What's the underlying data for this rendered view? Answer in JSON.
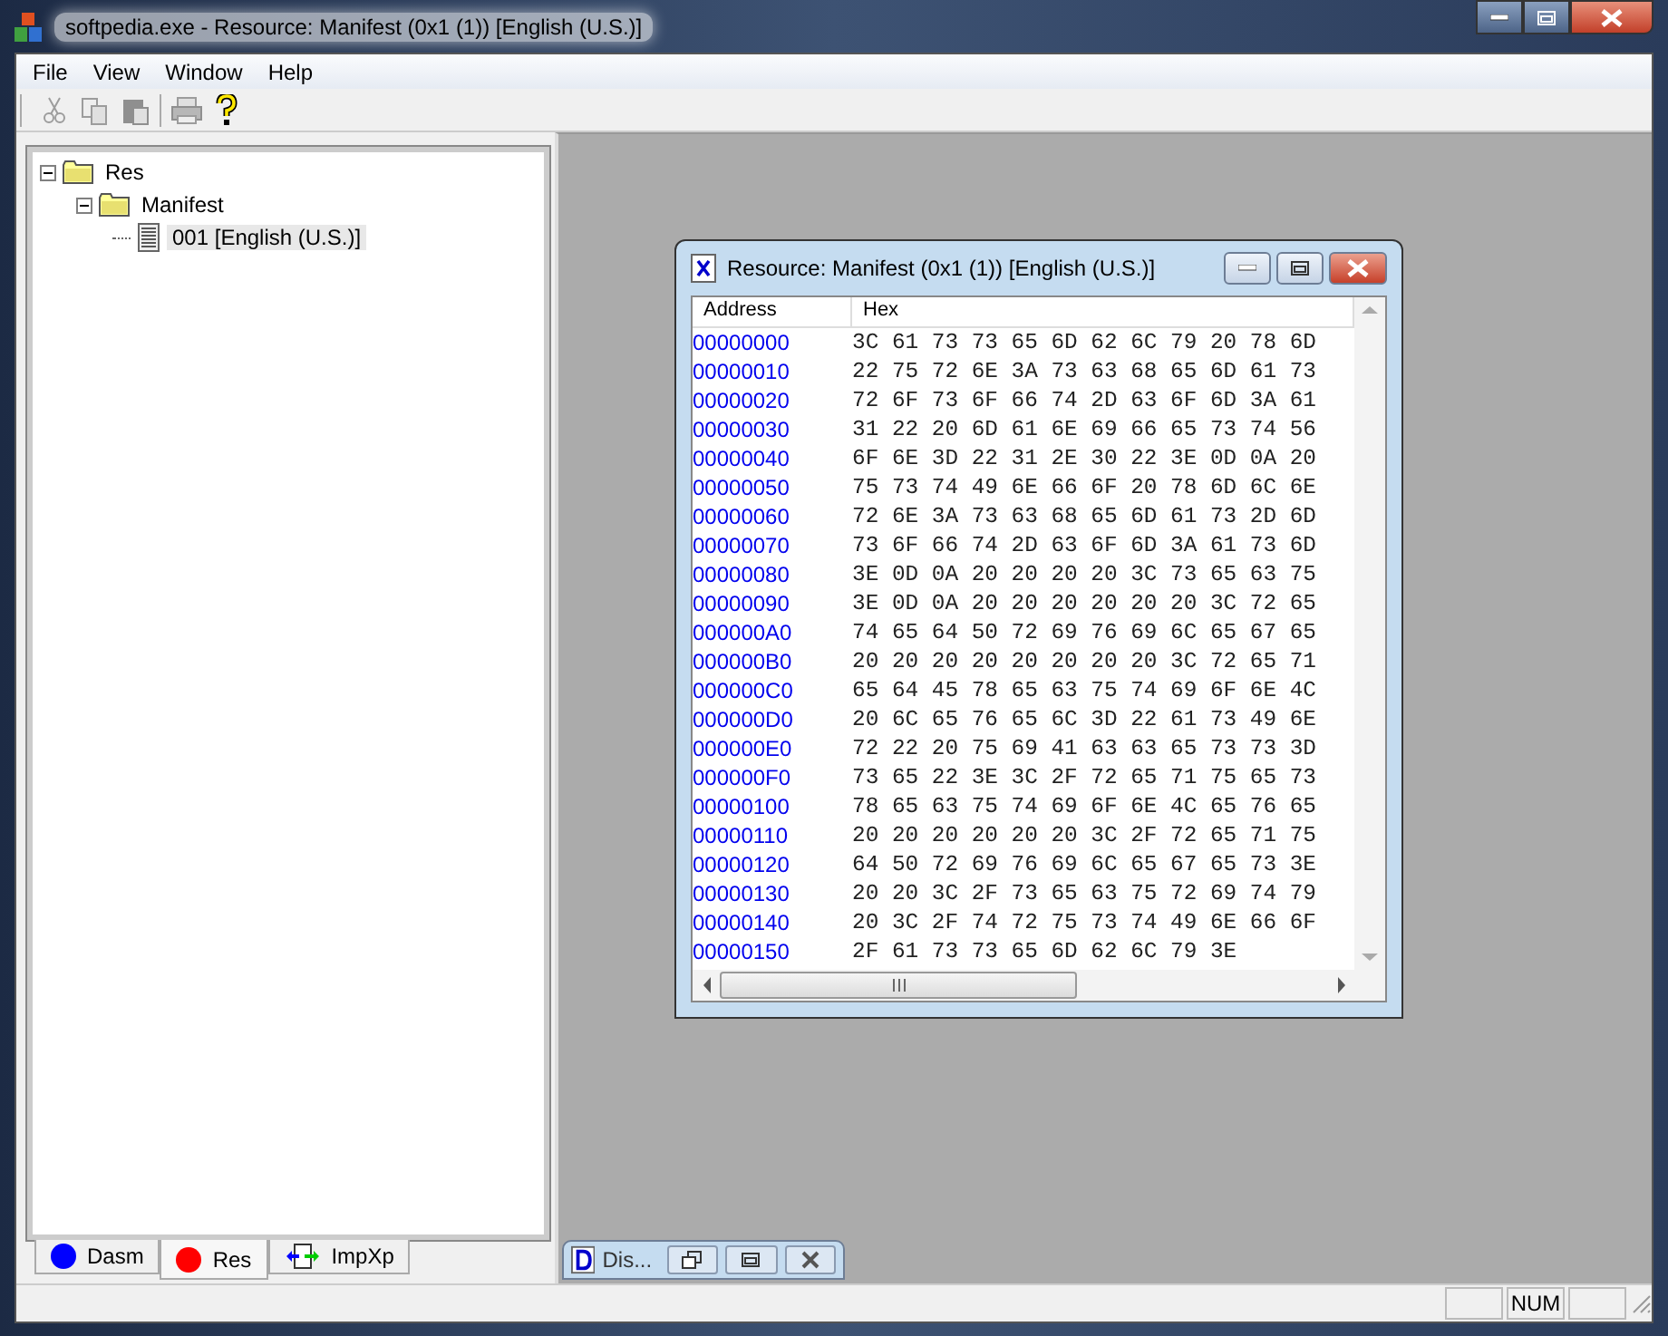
{
  "window": {
    "title": "softpedia.exe - Resource: Manifest (0x1 (1)) [English (U.S.)]"
  },
  "menu": [
    "File",
    "View",
    "Window",
    "Help"
  ],
  "toolbar": [
    {
      "kind": "cut",
      "disabled": true
    },
    {
      "kind": "copy",
      "disabled": true
    },
    {
      "kind": "paste",
      "disabled": true
    },
    {
      "kind": "print",
      "disabled": true
    },
    {
      "kind": "help",
      "disabled": false
    }
  ],
  "tree": [
    {
      "label": "Res",
      "kind": "folder",
      "expanded": true,
      "selected": false,
      "children": [
        {
          "label": "Manifest",
          "kind": "folder",
          "expanded": true,
          "selected": false,
          "children": [
            {
              "label": "001 [English (U.S.)]",
              "kind": "file",
              "selected": true
            }
          ]
        }
      ]
    }
  ],
  "panel_tabs": [
    {
      "label": "Dasm",
      "kind": "dot",
      "color": "#0000ff",
      "selected": false
    },
    {
      "label": "Res",
      "kind": "dot",
      "color": "#ff0000",
      "selected": true
    },
    {
      "label": "ImpXp",
      "kind": "arrows",
      "selected": false
    }
  ],
  "child_window": {
    "title": "Resource: Manifest (0x1 (1)) [English (U.S.)]",
    "columns": [
      "Address",
      "Hex"
    ],
    "rows": [
      {
        "address": "00000000",
        "hex": "3C 61 73 73 65 6D 62 6C 79 20 78 6D"
      },
      {
        "address": "00000010",
        "hex": "22 75 72 6E 3A 73 63 68 65 6D 61 73"
      },
      {
        "address": "00000020",
        "hex": "72 6F 73 6F 66 74 2D 63 6F 6D 3A 61"
      },
      {
        "address": "00000030",
        "hex": "31 22 20 6D 61 6E 69 66 65 73 74 56"
      },
      {
        "address": "00000040",
        "hex": "6F 6E 3D 22 31 2E 30 22 3E 0D 0A 20"
      },
      {
        "address": "00000050",
        "hex": "75 73 74 49 6E 66 6F 20 78 6D 6C 6E"
      },
      {
        "address": "00000060",
        "hex": "72 6E 3A 73 63 68 65 6D 61 73 2D 6D"
      },
      {
        "address": "00000070",
        "hex": "73 6F 66 74 2D 63 6F 6D 3A 61 73 6D"
      },
      {
        "address": "00000080",
        "hex": "3E 0D 0A 20 20 20 20 3C 73 65 63 75"
      },
      {
        "address": "00000090",
        "hex": "3E 0D 0A 20 20 20 20 20 20 3C 72 65"
      },
      {
        "address": "000000A0",
        "hex": "74 65 64 50 72 69 76 69 6C 65 67 65"
      },
      {
        "address": "000000B0",
        "hex": "20 20 20 20 20 20 20 20 3C 72 65 71"
      },
      {
        "address": "000000C0",
        "hex": "65 64 45 78 65 63 75 74 69 6F 6E 4C"
      },
      {
        "address": "000000D0",
        "hex": "20 6C 65 76 65 6C 3D 22 61 73 49 6E"
      },
      {
        "address": "000000E0",
        "hex": "72 22 20 75 69 41 63 63 65 73 73 3D"
      },
      {
        "address": "000000F0",
        "hex": "73 65 22 3E 3C 2F 72 65 71 75 65 73"
      },
      {
        "address": "00000100",
        "hex": "78 65 63 75 74 69 6F 6E 4C 65 76 65"
      },
      {
        "address": "00000110",
        "hex": "20 20 20 20 20 20 3C 2F 72 65 71 75"
      },
      {
        "address": "00000120",
        "hex": "64 50 72 69 76 69 6C 65 67 65 73 3E"
      },
      {
        "address": "00000130",
        "hex": "20 20 3C 2F 73 65 63 75 72 69 74 79"
      },
      {
        "address": "00000140",
        "hex": "20 3C 2F 74 72 75 73 74 49 6E 66 6F"
      },
      {
        "address": "00000150",
        "hex": "2F 61 73 73 65 6D 62 6C 79 3E"
      }
    ]
  },
  "minimized_window": {
    "title": "Dis..."
  },
  "status_bar": {
    "indicator": "NUM"
  }
}
